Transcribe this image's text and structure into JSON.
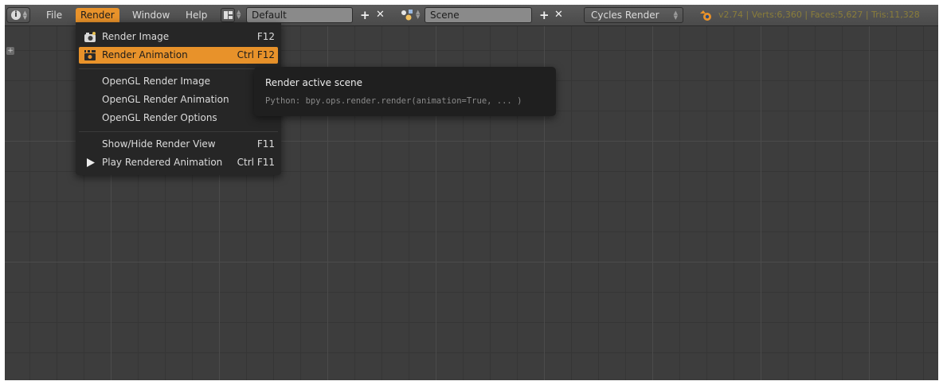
{
  "header": {
    "editor_icon": "info-icon",
    "menus": [
      "File",
      "Render",
      "Window",
      "Help"
    ],
    "active_menu": "Render",
    "screen_layout": {
      "icon": "screen-layout-icon",
      "value": "Default",
      "add_label": "+",
      "remove_label": "✕"
    },
    "scene": {
      "icon": "scene-icon",
      "value": "Scene",
      "add_label": "+",
      "remove_label": "✕"
    },
    "render_engine": "Cycles Render",
    "blender_icon": "blender-logo-icon",
    "stats": "v2.74 | Verts:6,360 | Faces:5,627 | Tris:11,328"
  },
  "render_menu": {
    "items": [
      {
        "label": "Render Image",
        "shortcut": "F12",
        "icon": "camera-icon"
      },
      {
        "label": "Render Animation",
        "shortcut": "Ctrl F12",
        "icon": "clapper-icon",
        "highlighted": true
      },
      {
        "label": "OpenGL Render Image",
        "shortcut": ""
      },
      {
        "label": "OpenGL Render Animation",
        "shortcut": ""
      },
      {
        "label": "OpenGL Render Options",
        "shortcut": ""
      },
      {
        "label": "Show/Hide Render View",
        "shortcut": "F11"
      },
      {
        "label": "Play Rendered Animation",
        "shortcut": "Ctrl F11",
        "icon": "play-icon"
      }
    ]
  },
  "tooltip": {
    "title": "Render active scene",
    "python": "Python: bpy.ops.render.render(animation=True, ... )"
  },
  "viewport": {
    "corner_widget": "+"
  },
  "colors": {
    "accent": "#e8922a",
    "background": "#3d3d3d",
    "menu_background": "#262626",
    "stats_text": "#8a7d3a"
  }
}
